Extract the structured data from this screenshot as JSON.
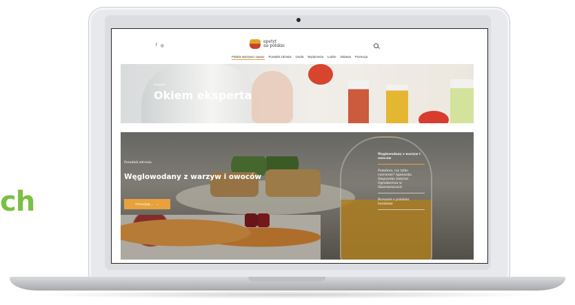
{
  "side_text": "ch",
  "site": {
    "social": [
      "f",
      "◎"
    ],
    "logo": {
      "line1": "apetyt",
      "line2": "na polskie"
    },
    "nav": [
      "Polskie warzywa i owoce",
      "Poradnik zdrowia",
      "Uroda",
      "Wydarzenia",
      "Ludzie",
      "Zabawa",
      "Promocja"
    ],
    "active_nav": 0
  },
  "banner1": {
    "category": "Kategoria",
    "title": "Okiem eksperta"
  },
  "banner2": {
    "category": "Poradnik zdrowia",
    "title": "Węglowodany z warzyw i owoców",
    "button_label": "Przeczytaj ...",
    "button_arrow": "→",
    "side_items": [
      "Węglowodany z warzyw i owoców",
      "Pomidory, czy tylko czerwone? Agnieszka Sieguweka Instytut Ogrodnictwa w Skierniewicach",
      "Browarie z polskimi burakami"
    ]
  }
}
